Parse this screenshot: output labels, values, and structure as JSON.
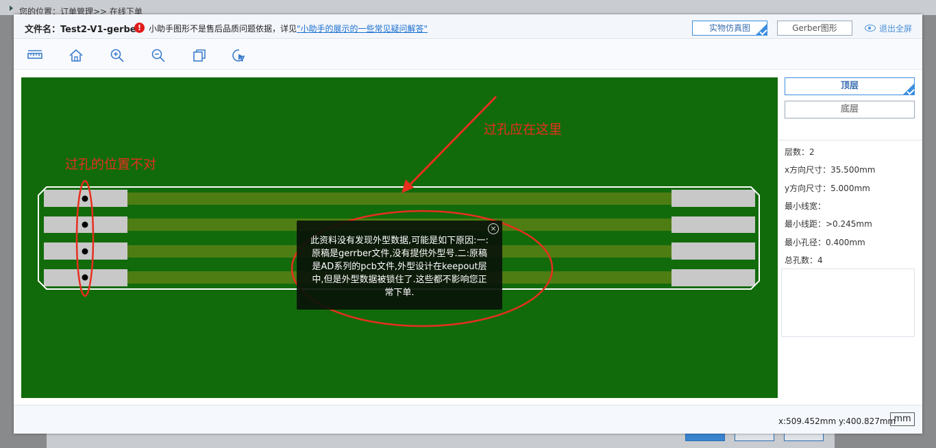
{
  "background": {
    "breadcrumb": "您的位置：订单管理>> 在线下单"
  },
  "header": {
    "file_label": "文件名：Test2-V1-gerber",
    "notice_prefix": "小助手图形不是售后品质问题依据，详见",
    "notice_link": "\"小助手的展示的一些常见疑问解答\"",
    "btn_realistic": "实物仿真图",
    "btn_gerber": "Gerber图形",
    "exit_fullscreen": "退出全屏"
  },
  "toolbar": {
    "tools": [
      "ruler-icon",
      "home-icon",
      "zoom-in-icon",
      "zoom-out-icon",
      "copy-icon",
      "cursor-icon"
    ]
  },
  "side": {
    "top_layer": "顶层",
    "bottom_layer": "底层",
    "stats": [
      "层数：2",
      "x方向尺寸：35.500mm",
      "y方向尺寸：5.000mm",
      "最小线宽：",
      "最小线距：>0.245mm",
      "最小孔径：0.400mm",
      "总孔数：4"
    ]
  },
  "popup": {
    "close": "×",
    "message": "此资料没有发现外型数据,可能是如下原因:一:原稿是gerrber文件,没有提供外型号.二:原稿是AD系列的pcb文件,外型设计在keepout层中,但是外型数据被锁住了.这些都不影响您正常下单."
  },
  "annotations": {
    "wrong_position": "过孔的位置不对",
    "should_be_here": "过孔应在这里"
  },
  "footer": {
    "coords": "x:509.452mm  y:400.827mm",
    "unit": "mm"
  },
  "colors": {
    "board": "#126b0b",
    "trace": "#4e7d13",
    "pad": "#c8c8c8",
    "annotation": "#e82e1e",
    "accent": "#3b8ee0"
  }
}
